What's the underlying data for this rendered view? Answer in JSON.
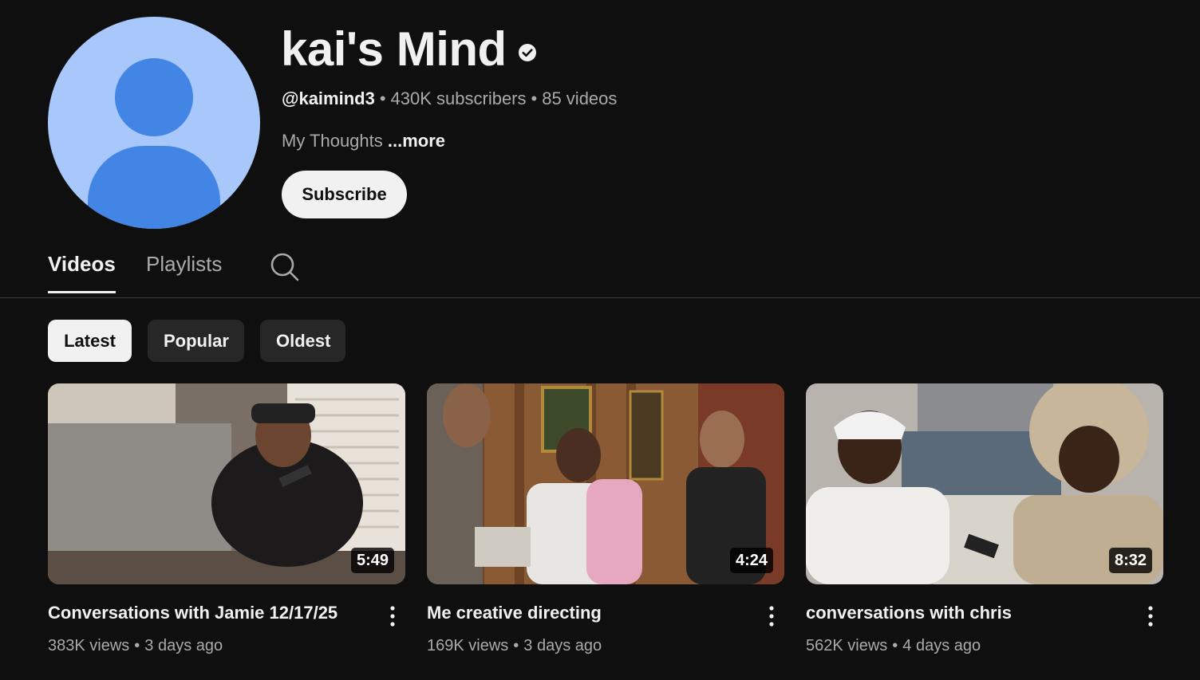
{
  "channel": {
    "name": "kai's Mind",
    "handle": "@kaimind3",
    "subscribers": "430K subscribers",
    "videos_count": "85 videos",
    "meta_separator": "•",
    "description": "My Thoughts",
    "more_label": "...more",
    "subscribe_label": "Subscribe",
    "avatar_icon": "default-avatar-icon",
    "verified_icon": "verified-checkmark-icon"
  },
  "tabs": [
    {
      "label": "Videos",
      "active": true
    },
    {
      "label": "Playlists",
      "active": false
    }
  ],
  "search_icon": "search-icon",
  "chips": [
    {
      "label": "Latest",
      "selected": true
    },
    {
      "label": "Popular",
      "selected": false
    },
    {
      "label": "Oldest",
      "selected": false
    }
  ],
  "videos": [
    {
      "title": "Conversations with Jamie 12/17/25",
      "duration": "5:49",
      "views": "383K views",
      "separator": "•",
      "age": "3 days ago"
    },
    {
      "title": "Me creative directing",
      "duration": "4:24",
      "views": "169K views",
      "separator": "•",
      "age": "3 days ago"
    },
    {
      "title": "conversations with chris",
      "duration": "8:32",
      "views": "562K views",
      "separator": "•",
      "age": "4 days ago"
    }
  ],
  "colors": {
    "background": "#0f0f0f",
    "text_primary": "#f1f1f1",
    "text_secondary": "#aaaaaa",
    "chip_bg": "#272727",
    "avatar_bg": "#a8c7fa",
    "avatar_fg": "#4285e5"
  }
}
